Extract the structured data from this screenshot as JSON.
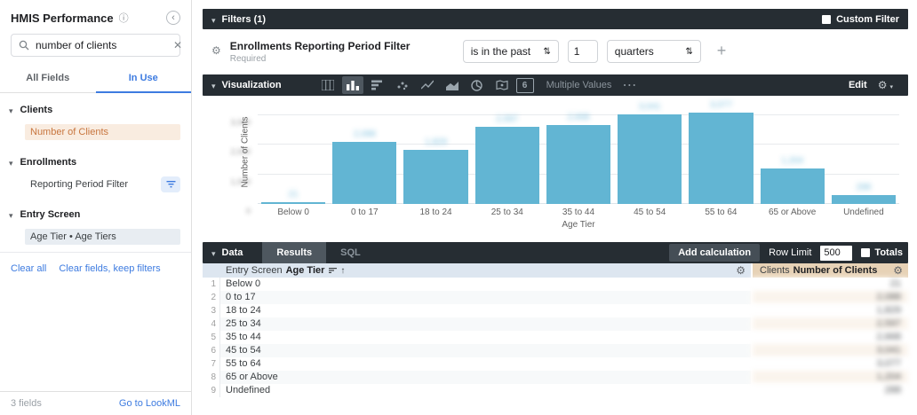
{
  "sidebar": {
    "title": "HMIS Performance",
    "search": {
      "value": "number of clients"
    },
    "tabs": {
      "all_fields": "All Fields",
      "in_use": "In Use"
    },
    "sections": [
      {
        "label": "Clients",
        "items": [
          {
            "label": "Number of Clients",
            "style": "measure-selected"
          }
        ]
      },
      {
        "label": "Enrollments",
        "items": [
          {
            "label": "Reporting Period Filter",
            "filter_button": true
          }
        ]
      },
      {
        "label": "Entry Screen",
        "items": [
          {
            "label": "Age Tier • Age Tiers",
            "style": "dimension-selected"
          }
        ]
      }
    ],
    "links": {
      "clear_all": "Clear all",
      "clear_fields": "Clear fields, keep filters"
    },
    "footer": {
      "fields_count": "3 fields",
      "lookml_link": "Go to LookML"
    }
  },
  "filters": {
    "header": "Filters (1)",
    "custom_filter_label": "Custom Filter",
    "row": {
      "field": "Enrollments Reporting Period Filter",
      "required": "Required",
      "condition": "is in the past",
      "amount": "1",
      "unit": "quarters"
    }
  },
  "visualization": {
    "header": "Visualization",
    "icons": [
      {
        "name": "table-chart-icon",
        "selected": false
      },
      {
        "name": "column-chart-icon",
        "selected": true
      },
      {
        "name": "bar-chart-icon",
        "selected": false
      },
      {
        "name": "scatter-chart-icon",
        "selected": false
      },
      {
        "name": "line-chart-icon",
        "selected": false
      },
      {
        "name": "area-chart-icon",
        "selected": false
      },
      {
        "name": "pie-chart-icon",
        "selected": false
      },
      {
        "name": "map-chart-icon",
        "selected": false
      },
      {
        "name": "single-value-icon",
        "selected": false,
        "glyph": "6"
      }
    ],
    "multiple_values_label": "Multiple Values",
    "edit_label": "Edit"
  },
  "chart_data": {
    "type": "bar",
    "categories": [
      "Below 0",
      "0 to 17",
      "18 to 24",
      "25 to 34",
      "35 to 44",
      "45 to 54",
      "55 to 64",
      "65 or Above",
      "Undefined"
    ],
    "values": [
      21,
      2088,
      1829,
      2597,
      2668,
      3041,
      3077,
      1204,
      288
    ],
    "value_labels": [
      "21",
      "2,088",
      "1,829",
      "2,597",
      "2,668",
      "3,041",
      "3,077",
      "1,204",
      "288"
    ],
    "values_redacted": true,
    "title": "",
    "xlabel": "Age Tier",
    "ylabel": "Number of Clients",
    "ylim": [
      0,
      3300
    ],
    "yticks": [
      {
        "value": 0,
        "label": "0"
      },
      {
        "value": 1000,
        "label": "1,000"
      },
      {
        "value": 2000,
        "label": "2,000"
      },
      {
        "value": 3000,
        "label": "3,000"
      }
    ],
    "grid": true,
    "legend": false,
    "bar_color": "#62b5d3"
  },
  "data_panel": {
    "header": "Data",
    "tabs": {
      "results": "Results",
      "sql": "SQL"
    },
    "add_calculation": "Add calculation",
    "row_limit_label": "Row Limit",
    "row_limit_value": "500",
    "totals_label": "Totals"
  },
  "table": {
    "col1_prefix": "Entry Screen",
    "col1_name": "Age Tier",
    "col2_prefix": "Clients",
    "col2_name": "Number of Clients",
    "values_redacted": true,
    "rows": [
      {
        "num": "1",
        "tier": "Below 0",
        "value": "21"
      },
      {
        "num": "2",
        "tier": "0 to 17",
        "value": "2,088"
      },
      {
        "num": "3",
        "tier": "18 to 24",
        "value": "1,829"
      },
      {
        "num": "4",
        "tier": "25 to 34",
        "value": "2,597"
      },
      {
        "num": "5",
        "tier": "35 to 44",
        "value": "2,668"
      },
      {
        "num": "6",
        "tier": "45 to 54",
        "value": "3,041"
      },
      {
        "num": "7",
        "tier": "55 to 64",
        "value": "3,077"
      },
      {
        "num": "8",
        "tier": "65 or Above",
        "value": "1,204"
      },
      {
        "num": "9",
        "tier": "Undefined",
        "value": "288"
      }
    ]
  },
  "colors": {
    "dark_bar": "#262d33",
    "accent_blue": "#3d7be0",
    "bar_fill": "#62b5d3",
    "measure_highlight_bg": "#f9ece0",
    "measure_highlight_text": "#c8763f",
    "dimension_highlight_bg": "#e8edf2",
    "dim_header_bg": "#dde6f0",
    "meas_header_bg": "#e7d2b6"
  }
}
